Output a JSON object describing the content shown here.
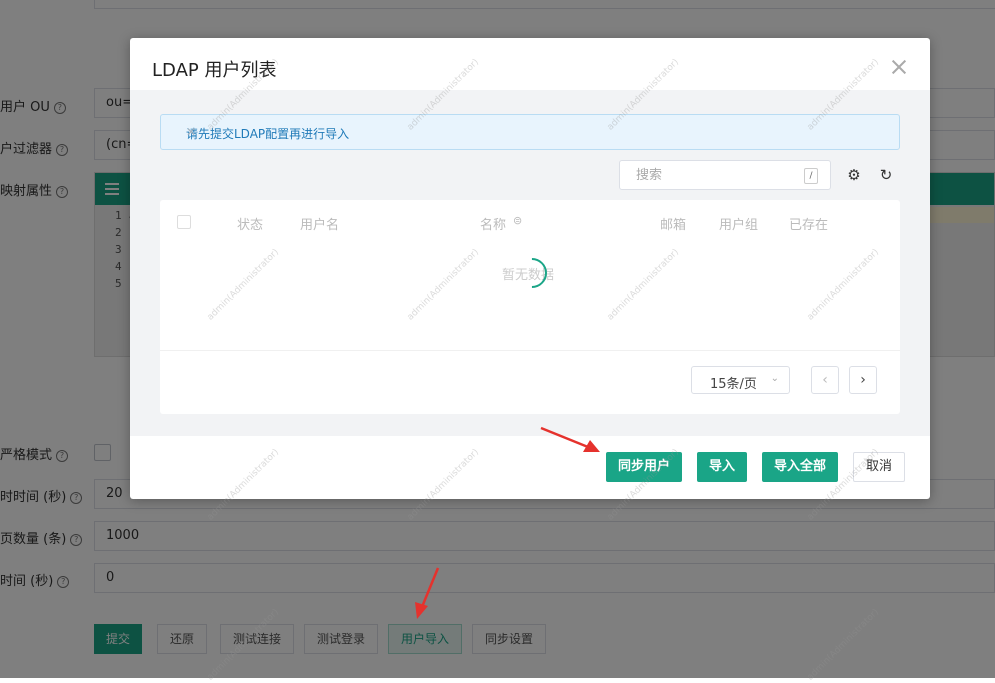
{
  "background_form": {
    "fields": [
      {
        "label": "用户 OU",
        "value": "ou="
      },
      {
        "label": "户过滤器",
        "value": "(cn="
      },
      {
        "label": "映射属性",
        "value": ""
      },
      {
        "label": "严格模式",
        "value": ""
      },
      {
        "label": "时时间 (秒)",
        "value": "20"
      },
      {
        "label": "页数量 (条)",
        "value": "1000"
      },
      {
        "label": "时间 (秒)",
        "value": "0"
      }
    ],
    "editor_line_numbers": [
      "1 ⌄",
      "2",
      "3",
      "4",
      "5"
    ],
    "buttons": {
      "submit": "提交",
      "restore": "还原",
      "test_connection": "测试连接",
      "test_login": "测试登录",
      "user_import": "用户导入",
      "sync_settings": "同步设置"
    }
  },
  "modal": {
    "title": "LDAP 用户列表",
    "alert": "请先提交LDAP配置再进行导入",
    "search": {
      "placeholder": "搜索",
      "shortcut": "/"
    },
    "table": {
      "columns": [
        "状态",
        "用户名",
        "名称",
        "邮箱",
        "用户组",
        "已存在"
      ],
      "sort_indicator": "⊜",
      "empty_text": "暂无数据"
    },
    "pagination": {
      "page_size": "15条/页"
    },
    "footer": {
      "sync_users": "同步用户",
      "import": "导入",
      "import_all": "导入全部",
      "cancel": "取消"
    }
  },
  "watermark": "admin(Administrator)",
  "colors": {
    "accent": "#1aa587",
    "annotation_arrow": "#e5322d"
  }
}
